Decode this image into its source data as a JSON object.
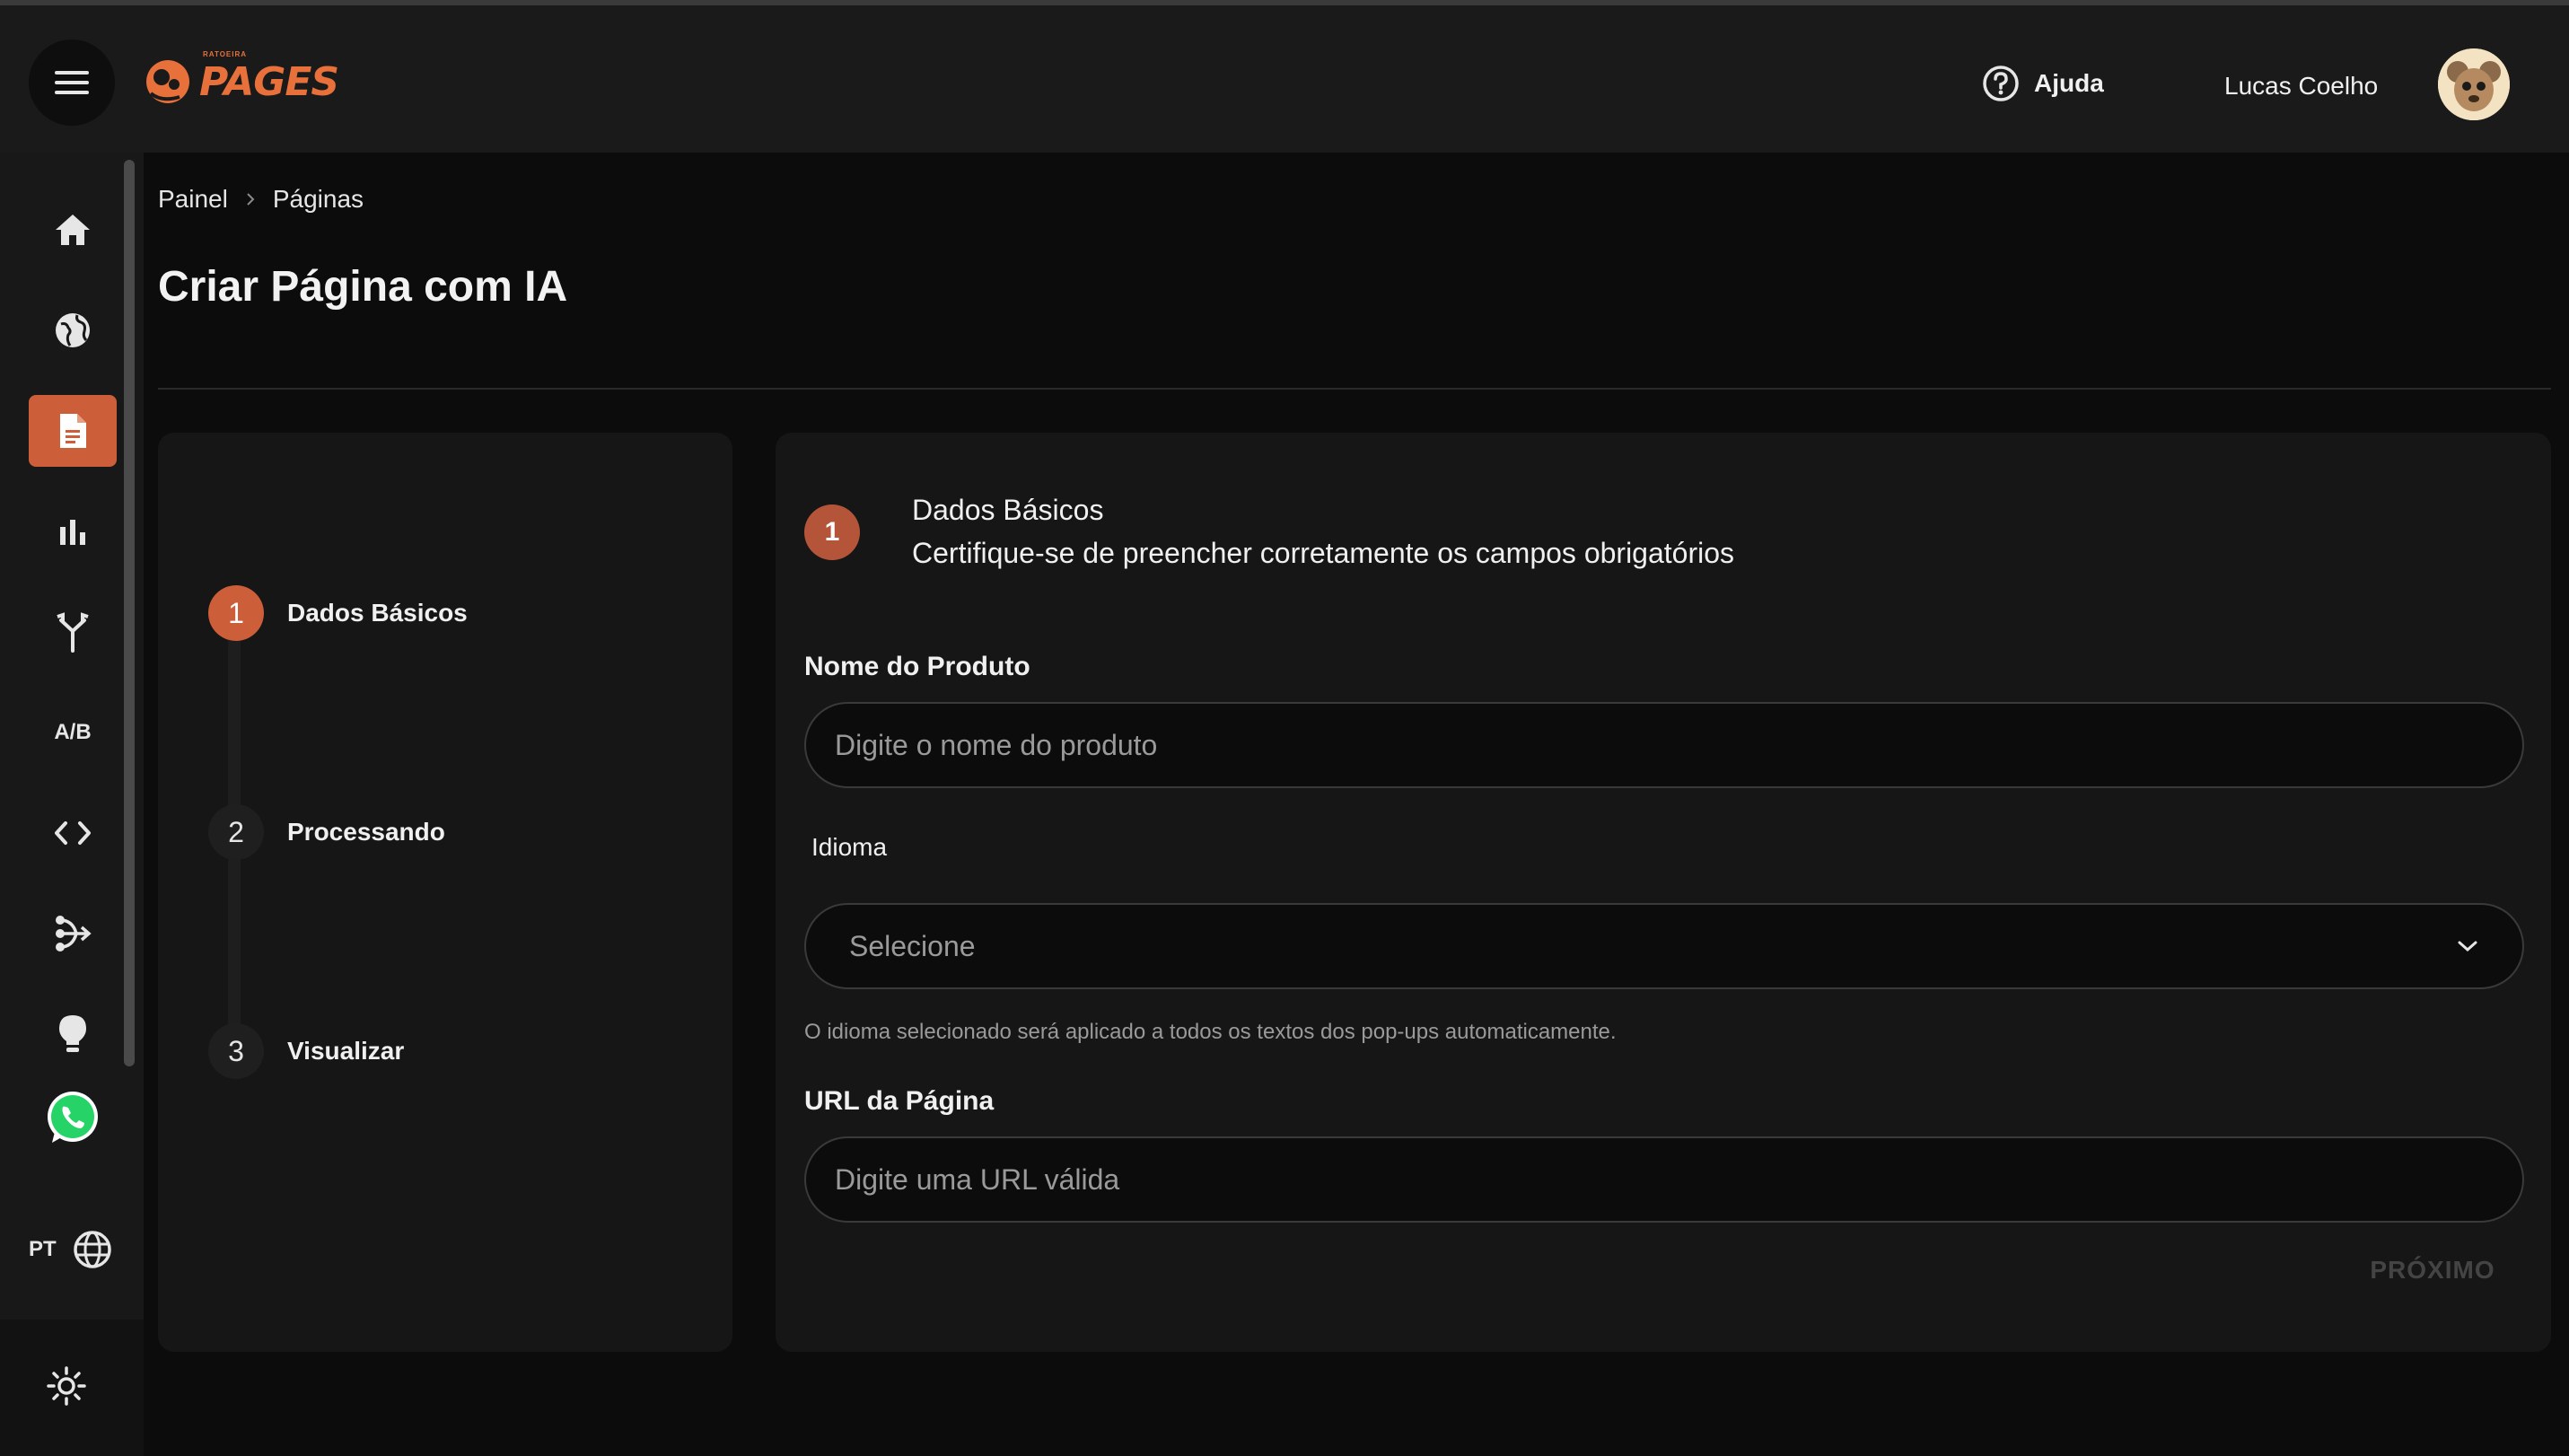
{
  "header": {
    "logo_small": "RATOEIRA",
    "logo_main": "PAGES",
    "help_label": "Ajuda",
    "user_name": "Lucas Coelho"
  },
  "sidebar": {
    "ab_label": "A/B",
    "lang_label": "PT",
    "active_color": "#cc5e3a"
  },
  "breadcrumb": {
    "items": [
      "Painel",
      "Páginas"
    ]
  },
  "page": {
    "title": "Criar Página com IA"
  },
  "steps": [
    {
      "number": "1",
      "label": "Dados Básicos"
    },
    {
      "number": "2",
      "label": "Processando"
    },
    {
      "number": "3",
      "label": "Visualizar"
    }
  ],
  "form": {
    "step_number": "1",
    "title": "Dados Básicos",
    "subtitle": "Certifique-se de preencher corretamente os campos obrigatórios",
    "product_label": "Nome do Produto",
    "product_placeholder": "Digite o nome do produto",
    "language_label": "Idioma",
    "language_value": "Selecione",
    "language_help": "O idioma selecionado será aplicado a todos os textos dos pop-ups automaticamente.",
    "url_label": "URL da Página",
    "url_placeholder": "Digite uma URL válida",
    "next_label": "PRÓXIMO"
  }
}
